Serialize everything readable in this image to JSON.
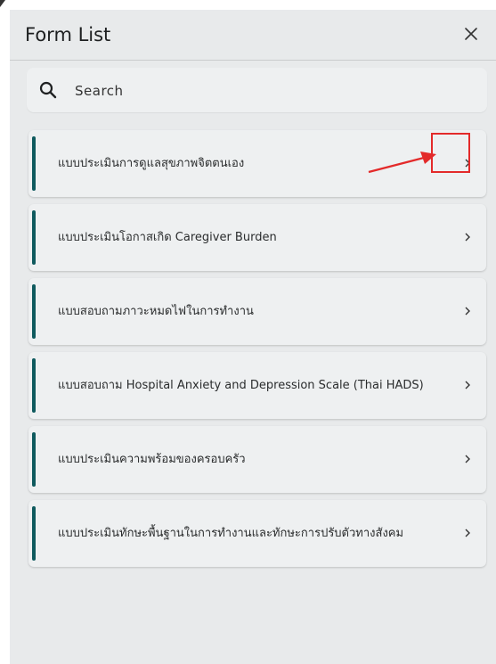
{
  "header": {
    "title": "Form List",
    "close_icon": "close-icon"
  },
  "search": {
    "placeholder": "Search",
    "icon": "search-icon"
  },
  "forms": [
    {
      "label": "แบบประเมินการดูแลสุขภาพจิตตนเอง"
    },
    {
      "label": "แบบประเมินโอกาสเกิด Caregiver Burden"
    },
    {
      "label": "แบบสอบถามภาวะหมดไฟในการทำงาน"
    },
    {
      "label": "แบบสอบถาม Hospital Anxiety and Depression Scale (Thai HADS)"
    },
    {
      "label": "แบบประเมินความพร้อมของครอบครัว"
    },
    {
      "label": "แบบประเมินทักษะพื้นฐานในการทำงานและทักษะการปรับตัวทางสังคม"
    }
  ],
  "colors": {
    "panel_bg": "#e8eaeb",
    "accent_bar": "#0f5a5e",
    "annotation_red": "#e32a2a"
  }
}
